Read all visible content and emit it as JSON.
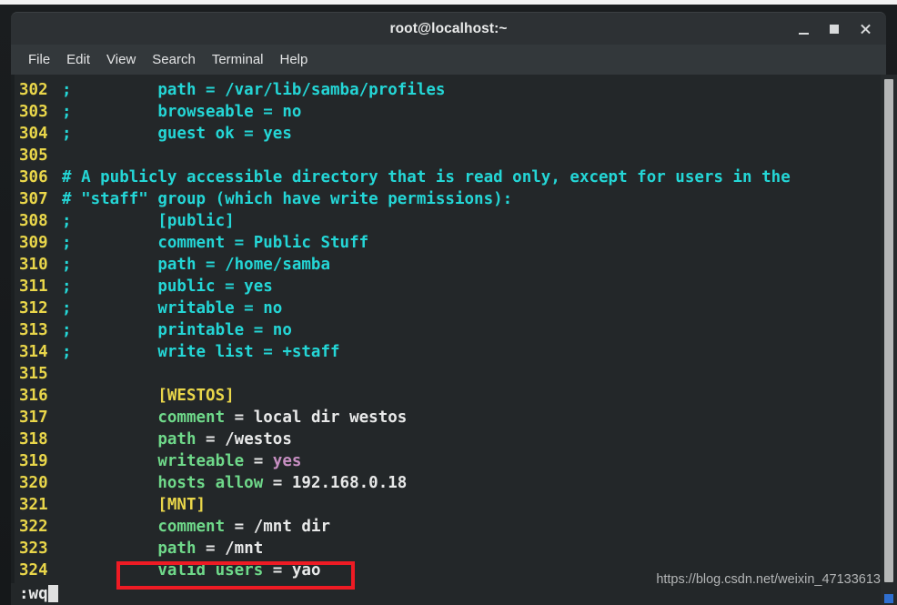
{
  "window": {
    "title": "root@localhost:~",
    "controls": [
      {
        "name": "minimize",
        "label": "–"
      },
      {
        "name": "maximize",
        "label": "□"
      },
      {
        "name": "close",
        "label": "×"
      }
    ]
  },
  "menubar": {
    "items": [
      "File",
      "Edit",
      "View",
      "Search",
      "Terminal",
      "Help"
    ]
  },
  "editor": {
    "application": "vim",
    "command_line": ":wq",
    "lines": [
      {
        "no": "302",
        "segments": [
          {
            "text": ";         path = /var/lib/samba/profiles",
            "style": "c-comment"
          }
        ]
      },
      {
        "no": "303",
        "segments": [
          {
            "text": ";         browseable = no",
            "style": "c-comment"
          }
        ]
      },
      {
        "no": "304",
        "segments": [
          {
            "text": ";         guest ok = yes",
            "style": "c-comment"
          }
        ]
      },
      {
        "no": "305",
        "segments": [
          {
            "text": "",
            "style": "ltext"
          }
        ]
      },
      {
        "no": "306",
        "segments": [
          {
            "text": "# A publicly accessible directory that is read only, except for users in the",
            "style": "c-comment"
          }
        ]
      },
      {
        "no": "307",
        "segments": [
          {
            "text": "# \"staff\" group (which have write permissions):",
            "style": "c-comment"
          }
        ]
      },
      {
        "no": "308",
        "segments": [
          {
            "text": ";         [public]",
            "style": "c-comment"
          }
        ]
      },
      {
        "no": "309",
        "segments": [
          {
            "text": ";         comment = Public Stuff",
            "style": "c-comment"
          }
        ]
      },
      {
        "no": "310",
        "segments": [
          {
            "text": ";         path = /home/samba",
            "style": "c-comment"
          }
        ]
      },
      {
        "no": "311",
        "segments": [
          {
            "text": ";         public = yes",
            "style": "c-comment"
          }
        ]
      },
      {
        "no": "312",
        "segments": [
          {
            "text": ";         writable = no",
            "style": "c-comment"
          }
        ]
      },
      {
        "no": "313",
        "segments": [
          {
            "text": ";         printable = no",
            "style": "c-comment"
          }
        ]
      },
      {
        "no": "314",
        "segments": [
          {
            "text": ";         write list = +staff",
            "style": "c-comment"
          }
        ]
      },
      {
        "no": "315",
        "segments": [
          {
            "text": "",
            "style": "ltext"
          }
        ]
      },
      {
        "no": "316",
        "segments": [
          {
            "text": "          ",
            "style": "ltext"
          },
          {
            "text": "[WESTOS]",
            "style": "c-section"
          }
        ]
      },
      {
        "no": "317",
        "segments": [
          {
            "text": "          ",
            "style": "ltext"
          },
          {
            "text": "comment",
            "style": "c-key"
          },
          {
            "text": " = local dir westos",
            "style": "c-val"
          }
        ]
      },
      {
        "no": "318",
        "segments": [
          {
            "text": "          ",
            "style": "ltext"
          },
          {
            "text": "path",
            "style": "c-key"
          },
          {
            "text": " = /westos",
            "style": "c-val"
          }
        ]
      },
      {
        "no": "319",
        "segments": [
          {
            "text": "          ",
            "style": "ltext"
          },
          {
            "text": "writeable",
            "style": "c-key"
          },
          {
            "text": " = ",
            "style": "c-val"
          },
          {
            "text": "yes",
            "style": "c-bool"
          }
        ]
      },
      {
        "no": "320",
        "segments": [
          {
            "text": "          ",
            "style": "ltext"
          },
          {
            "text": "hosts allow",
            "style": "c-key"
          },
          {
            "text": " = 192.168.0.18",
            "style": "c-val"
          }
        ]
      },
      {
        "no": "321",
        "segments": [
          {
            "text": "          ",
            "style": "ltext"
          },
          {
            "text": "[MNT]",
            "style": "c-section"
          }
        ]
      },
      {
        "no": "322",
        "segments": [
          {
            "text": "          ",
            "style": "ltext"
          },
          {
            "text": "comment",
            "style": "c-key"
          },
          {
            "text": " = /mnt dir",
            "style": "c-val"
          }
        ]
      },
      {
        "no": "323",
        "segments": [
          {
            "text": "          ",
            "style": "ltext"
          },
          {
            "text": "path",
            "style": "c-key"
          },
          {
            "text": " = /mnt",
            "style": "c-val"
          }
        ]
      },
      {
        "no": "324",
        "segments": [
          {
            "text": "          ",
            "style": "ltext"
          },
          {
            "text": "valid users",
            "style": "c-key"
          },
          {
            "text": " = yao",
            "style": "c-val"
          }
        ]
      }
    ]
  },
  "annotation": {
    "highlight_color": "#ee1b24",
    "highlighted_line_no": "324",
    "highlighted_text": "valid users = yao"
  },
  "watermark": {
    "url": "https://blog.csdn.net/weixin_47133613",
    "ghost": ""
  },
  "colors": {
    "terminal_bg": "#232729",
    "titlebar_bg": "#2d3134",
    "menubar_bg": "#33383b",
    "line_number": "#e9d64a",
    "comment": "#24d6d6",
    "section": "#e9d64a",
    "key": "#6fd98a",
    "value": "#e8e9e9",
    "boolean": "#c78fc2",
    "annotation_red": "#ee1b24"
  }
}
